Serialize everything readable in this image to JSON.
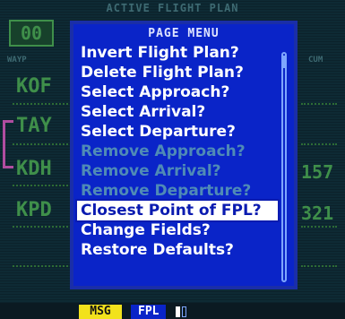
{
  "background": {
    "title": "ACTIVE FLIGHT PLAN",
    "code": "00",
    "header_left": "WAYP",
    "header_right": "CUM",
    "waypoints": [
      "KOF",
      "TAY",
      "KDH",
      "KPD"
    ],
    "right_values": [
      "157",
      "321"
    ]
  },
  "menu": {
    "title": "PAGE MENU",
    "items": [
      {
        "label": "Invert Flight Plan?",
        "state": "enabled"
      },
      {
        "label": "Delete Flight Plan?",
        "state": "enabled"
      },
      {
        "label": "Select Approach?",
        "state": "enabled"
      },
      {
        "label": "Select Arrival?",
        "state": "enabled"
      },
      {
        "label": "Select Departure?",
        "state": "enabled"
      },
      {
        "label": "Remove Approach?",
        "state": "disabled"
      },
      {
        "label": "Remove Arrival?",
        "state": "disabled"
      },
      {
        "label": "Remove Departure?",
        "state": "disabled"
      },
      {
        "label": "Closest Point of FPL?",
        "state": "selected"
      },
      {
        "label": "Change Fields?",
        "state": "enabled"
      },
      {
        "label": "Restore Defaults?",
        "state": "enabled"
      }
    ]
  },
  "status": {
    "msg_label": "MSG",
    "fpl_label": "FPL"
  },
  "colors": {
    "menu_bg": "#0a24c8",
    "selected_bg": "#ffffff",
    "disabled_text": "#4f8bb6",
    "msg_bg": "#f2e21c"
  }
}
